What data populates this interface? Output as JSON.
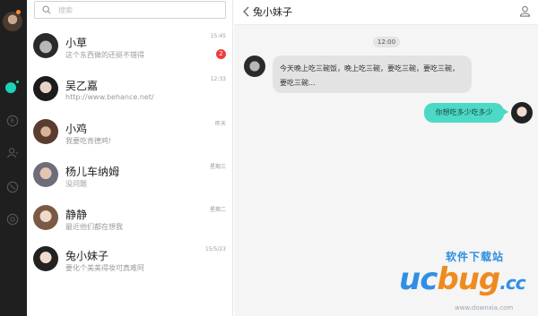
{
  "search": {
    "placeholder": "搜索"
  },
  "conversations": [
    {
      "name": "小草",
      "preview": "这个东西做的还挺不错得",
      "time": "15:45",
      "badge": "2"
    },
    {
      "name": "吴乙嘉",
      "preview": "http://www.behance.net/",
      "time": "12:33",
      "badge": ""
    },
    {
      "name": "小鸡",
      "preview": "我要吃肯德鸡!",
      "time": "昨天",
      "badge": ""
    },
    {
      "name": "杨儿车纳姆",
      "preview": "没问题",
      "time": "星期三",
      "badge": ""
    },
    {
      "name": "静静",
      "preview": "最近他们都在想我",
      "time": "星期二",
      "badge": ""
    },
    {
      "name": "兔小妹子",
      "preview": "要化个美美得妆可真难阿",
      "time": "15/5/23",
      "badge": ""
    }
  ],
  "chat": {
    "title": "兔小妹子",
    "timestamp": "12:00",
    "messages": [
      {
        "direction": "incoming",
        "text": "今天晚上吃三碗饭，晚上吃三碗，要吃三碗，要吃三碗，要吃三碗..."
      },
      {
        "direction": "outgoing",
        "text": "你想吃多少吃多少"
      }
    ]
  },
  "watermark": {
    "top": "软件下载站",
    "logo_u": "uc",
    "logo_b": "bug",
    "logo_c": ".cc",
    "url": "www.downxia.com"
  },
  "colors": {
    "rail": "#1f1f1f",
    "accent": "#1ad3b8",
    "outgoing_bubble": "#4cd9c6",
    "incoming_bubble": "#e3e3e3",
    "badge": "#f03b3b"
  },
  "icons": [
    "search-icon",
    "back-chevron-icon",
    "profile-icon",
    "chat-icon",
    "registered-icon",
    "contacts-icon",
    "compass-icon",
    "at-icon"
  ]
}
